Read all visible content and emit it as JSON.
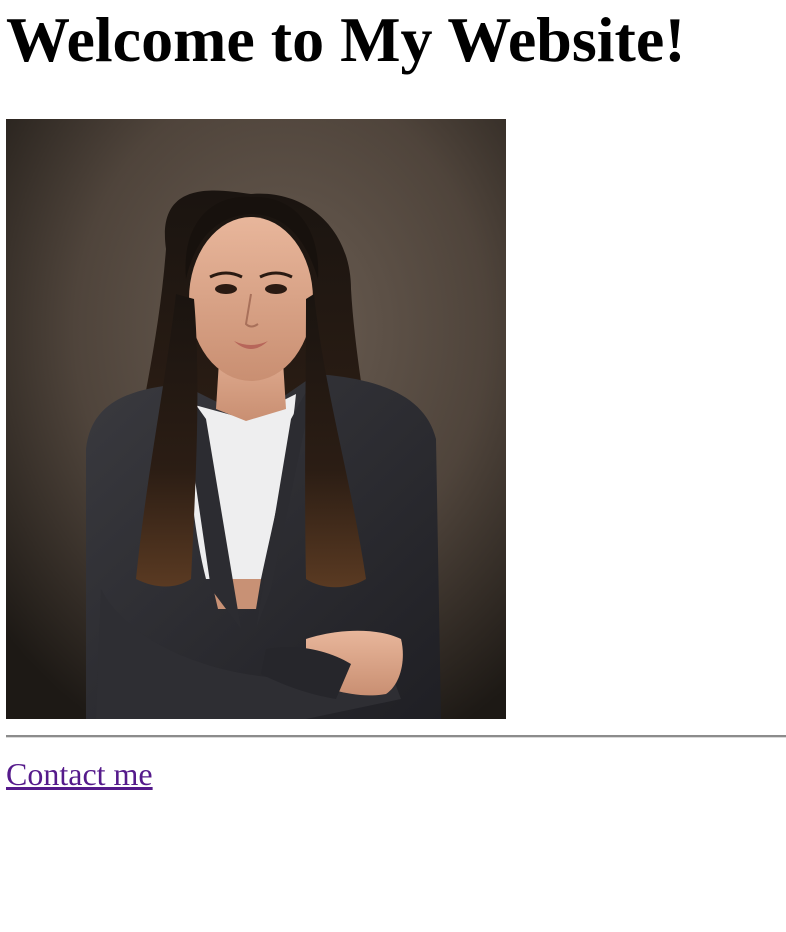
{
  "page": {
    "heading": "Welcome to My Website!",
    "link_label": "Contact me"
  },
  "colors": {
    "background": "#ffffff",
    "text": "#000000",
    "visited_link": "#551a8b",
    "divider": "#8c8c8c"
  },
  "photo": {
    "subject": "portrait-photo"
  }
}
